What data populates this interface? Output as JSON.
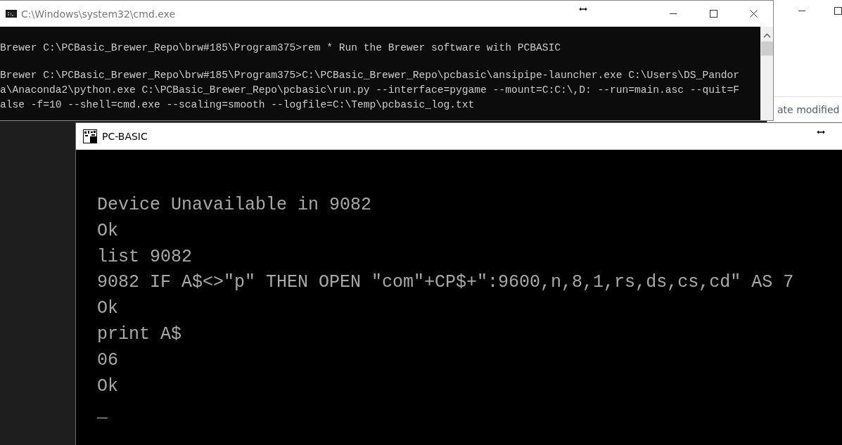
{
  "background_window": {
    "column_header": "ate modified"
  },
  "console_window": {
    "title": "C:\\Windows\\system32\\cmd.exe",
    "blocks": [
      [
        "Brewer C:\\PCBasic_Brewer_Repo\\brw#185\\Program375>rem * Run the Brewer software with PCBASIC"
      ],
      [
        "Brewer C:\\PCBasic_Brewer_Repo\\brw#185\\Program375>C:\\PCBasic_Brewer_Repo\\pcbasic\\ansipipe-launcher.exe C:\\Users\\DS_Pandor",
        "a\\Anaconda2\\python.exe C:\\PCBasic_Brewer_Repo\\pcbasic\\run.py --interface=pygame --mount=C:C:\\,D: --run=main.asc --quit=F",
        "alse -f=10 --shell=cmd.exe --scaling=smooth --logfile=C:\\Temp\\pcbasic_log.txt"
      ]
    ]
  },
  "basic_window": {
    "title": "PC-BASIC",
    "lines": [
      "Device Unavailable in 9082",
      "Ok",
      "list 9082",
      "9082 IF A$<>\"p\" THEN OPEN \"com\"+CP$+\":9600,n,8,1,rs,ds,cs,cd\" AS 7",
      "Ok",
      "print A$",
      "06",
      "Ok"
    ],
    "cursor": "_"
  }
}
